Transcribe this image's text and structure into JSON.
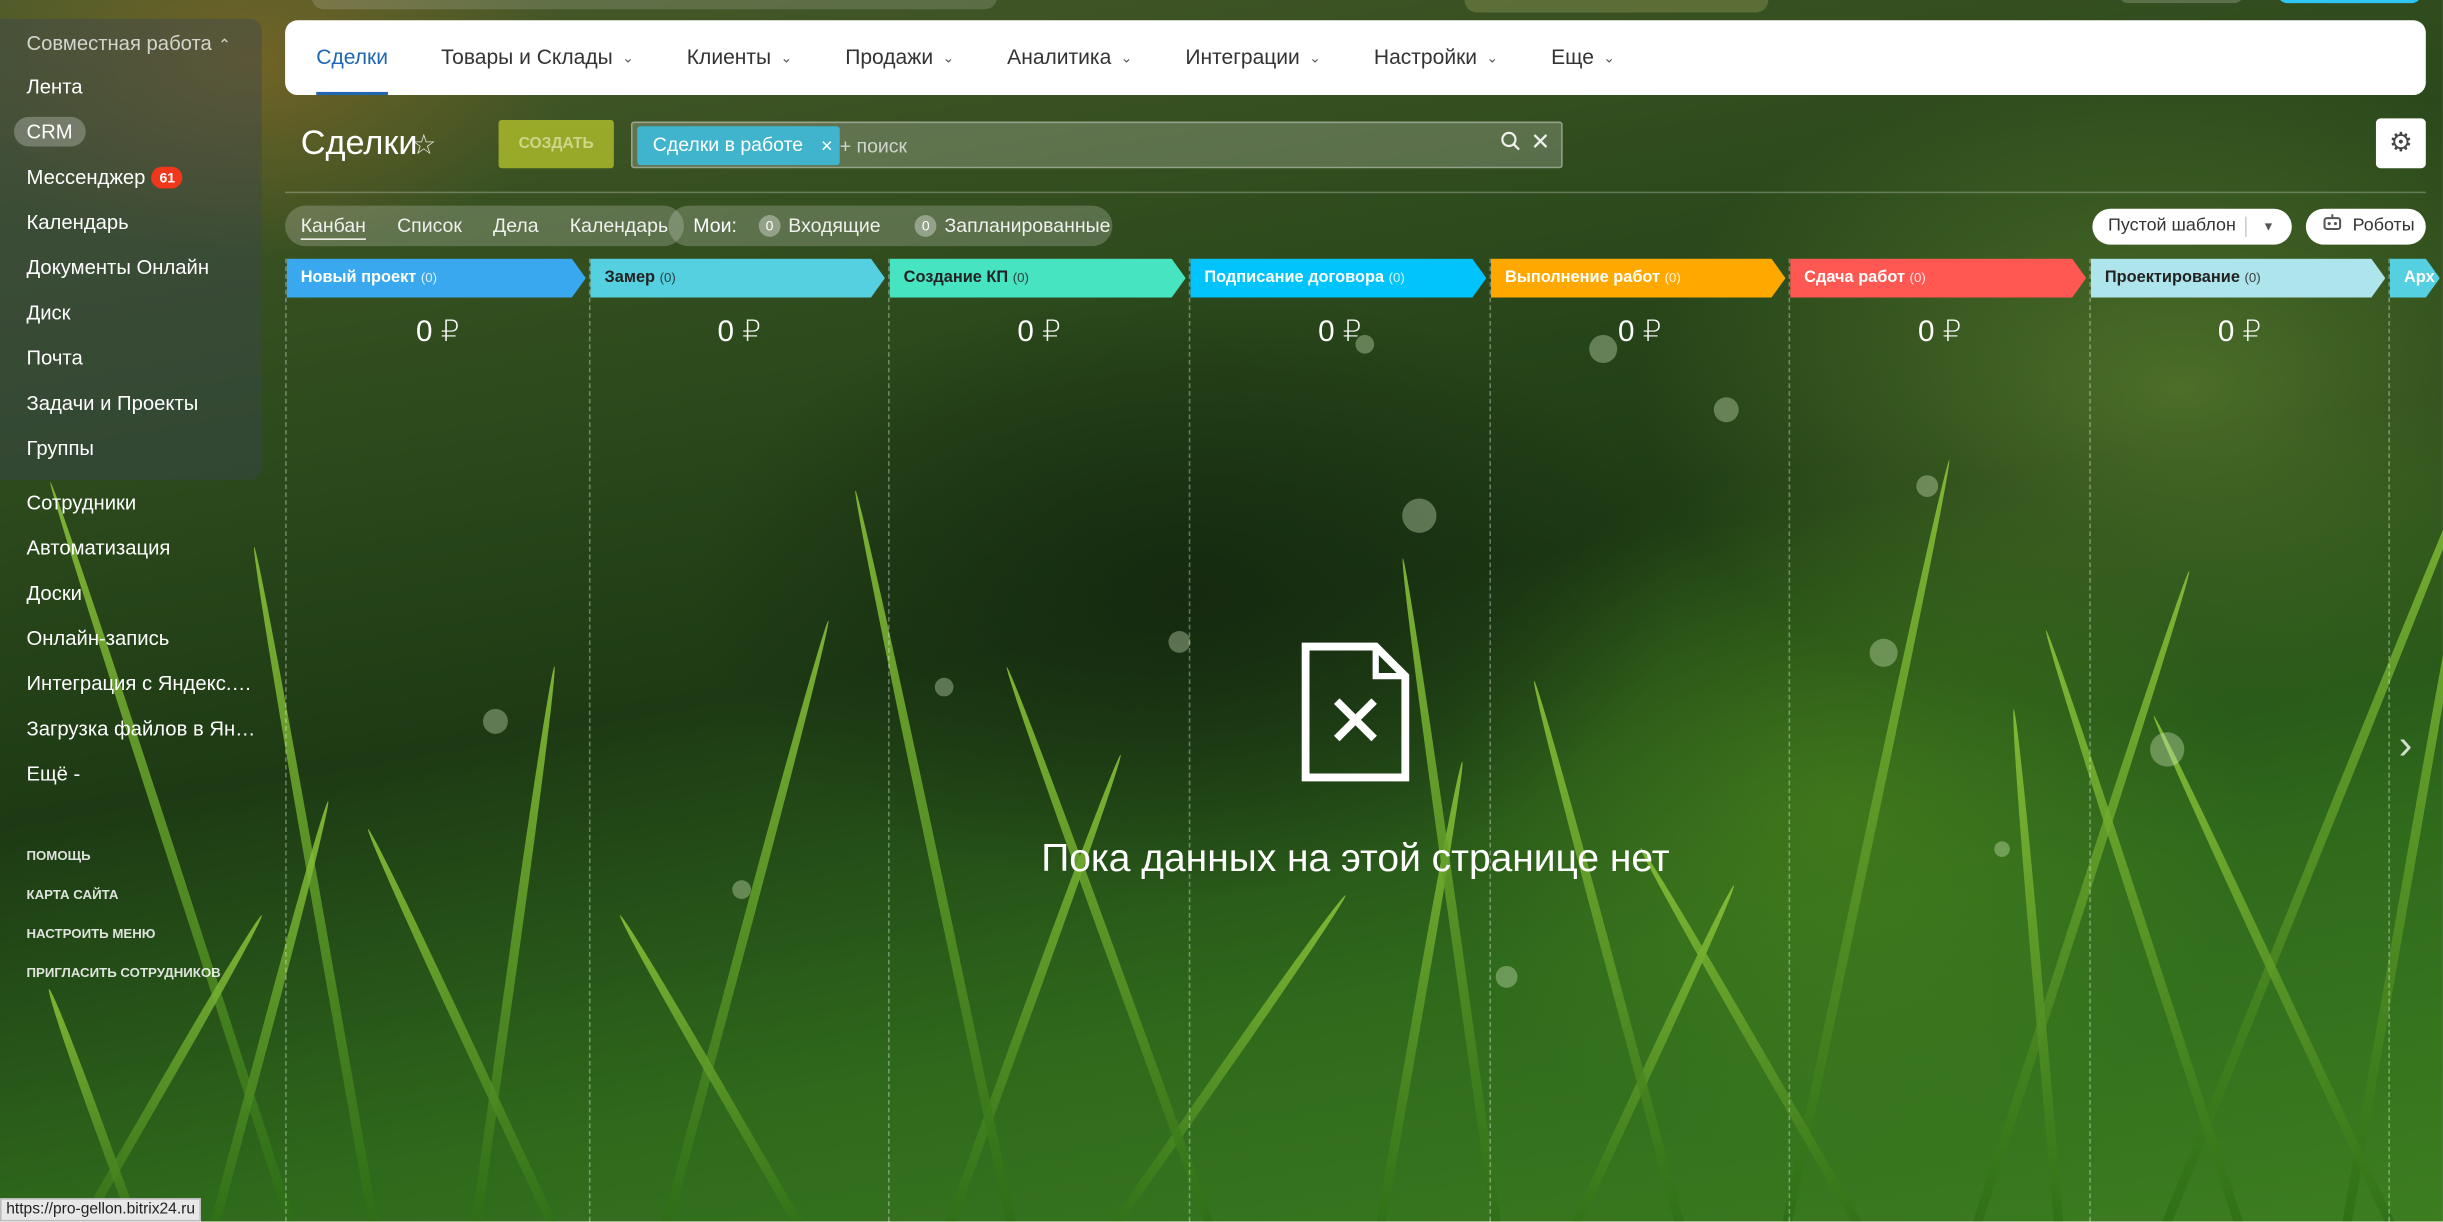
{
  "left_menu": {
    "group_title": "Совместная работа",
    "group_items": [
      {
        "label": "Лента"
      },
      {
        "label": "CRM"
      },
      {
        "label": "Мессенджер",
        "badge": "61"
      },
      {
        "label": "Календарь"
      },
      {
        "label": "Документы Онлайн"
      },
      {
        "label": "Диск"
      },
      {
        "label": "Почта"
      },
      {
        "label": "Задачи и Проекты"
      },
      {
        "label": "Группы"
      }
    ],
    "items": [
      {
        "label": "Сотрудники"
      },
      {
        "label": "Автоматизация"
      },
      {
        "label": "Доски"
      },
      {
        "label": "Онлайн-запись"
      },
      {
        "label": "Интеграция с Яндекс.Диск"
      },
      {
        "label": "Загрузка файлов в Яндекс..."
      },
      {
        "label": "Ещё -"
      }
    ],
    "small_links": [
      {
        "label": "ПОМОЩЬ"
      },
      {
        "label": "КАРТА САЙТА"
      },
      {
        "label": "НАСТРОИТЬ МЕНЮ"
      },
      {
        "label": "ПРИГЛАСИТЬ СОТРУДНИКОВ"
      }
    ]
  },
  "topnav": {
    "items": [
      {
        "label": "Сделки"
      },
      {
        "label": "Товары и Склады"
      },
      {
        "label": "Клиенты"
      },
      {
        "label": "Продажи"
      },
      {
        "label": "Аналитика"
      },
      {
        "label": "Интеграции"
      },
      {
        "label": "Настройки"
      },
      {
        "label": "Еще"
      }
    ]
  },
  "header": {
    "title": "Сделки",
    "create_label": "СОЗДАТЬ",
    "filter_chip": "Сделки в работе",
    "search_placeholder": "+ поиск"
  },
  "views": {
    "items": [
      {
        "label": "Канбан"
      },
      {
        "label": "Список"
      },
      {
        "label": "Дела"
      },
      {
        "label": "Календарь"
      }
    ],
    "mine_label": "Мои:",
    "incoming_count": "0",
    "incoming_label": "Входящие",
    "planned_count": "0",
    "planned_label": "Запланированные",
    "template_label": "Пустой шаблон",
    "robots_label": "Роботы"
  },
  "kanban": {
    "columns": [
      {
        "title": "Новый проект",
        "count": "(0)",
        "sum": "0 ₽",
        "color": "#39a8ef"
      },
      {
        "title": "Замер",
        "count": "(0)",
        "sum": "0 ₽",
        "color": "#55d0e0"
      },
      {
        "title": "Создание КП",
        "count": "(0)",
        "sum": "0 ₽",
        "color": "#47e4c2"
      },
      {
        "title": "Подписание договора",
        "count": "(0)",
        "sum": "0 ₽",
        "color": "#00c4fb"
      },
      {
        "title": "Выполнение работ",
        "count": "(0)",
        "sum": "0 ₽",
        "color": "#ffa900"
      },
      {
        "title": "Сдача работ",
        "count": "(0)",
        "sum": "0 ₽",
        "color": "#ff5752"
      },
      {
        "title": "Проектирование",
        "count": "(0)",
        "sum": "0 ₽",
        "color": "#aee5ec"
      },
      {
        "title": "Арх",
        "count": "",
        "sum": "",
        "color": "#55d0e0"
      }
    ],
    "empty_text": "Пока данных на этой странице нет"
  },
  "status_bar": {
    "url": "https://pro-gellon.bitrix24.ru"
  }
}
